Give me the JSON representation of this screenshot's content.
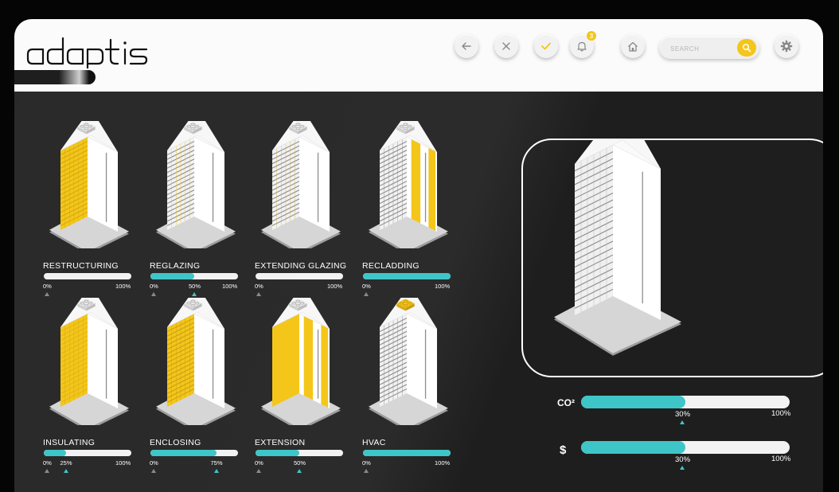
{
  "app": {
    "logo_text": "adaptis"
  },
  "header": {
    "notification_count": "3",
    "search_placeholder": "SEARCH",
    "icons": [
      "back-arrow-icon",
      "close-icon",
      "check-icon",
      "bell-icon",
      "home-icon",
      "search-icon",
      "gear-icon"
    ]
  },
  "colors": {
    "accent_yellow": "#f4c61a",
    "accent_teal": "#3ec5c8",
    "background": "#1e1e1e",
    "header": "#fbfbfb"
  },
  "strategies": [
    {
      "name": "RESTRUCTURING",
      "value_pct": 0,
      "ticks": [
        "0%",
        "100%"
      ]
    },
    {
      "name": "REGLAZING",
      "value_pct": 50,
      "ticks": [
        "0%",
        "50%",
        "100%"
      ]
    },
    {
      "name": "EXTENDING GLAZING",
      "value_pct": 0,
      "ticks": [
        "0%",
        "100%"
      ]
    },
    {
      "name": "RECLADDING",
      "value_pct": 100,
      "ticks": [
        "0%",
        "100%"
      ]
    },
    {
      "name": "INSULATING",
      "value_pct": 25,
      "ticks": [
        "0%",
        "25%",
        "100%"
      ]
    },
    {
      "name": "ENCLOSING",
      "value_pct": 75,
      "ticks": [
        "0%",
        "75%"
      ]
    },
    {
      "name": "EXTENSION",
      "value_pct": 50,
      "ticks": [
        "0%",
        "50%"
      ]
    },
    {
      "name": "HVAC",
      "value_pct": 100,
      "ticks": [
        "0%",
        "100%"
      ]
    }
  ],
  "metrics": [
    {
      "label": "CO²",
      "value_pct": 50,
      "ticks": [
        "30%",
        "100%"
      ]
    },
    {
      "label": "$",
      "value_pct": 50,
      "ticks": [
        "30%",
        "100%"
      ]
    }
  ]
}
